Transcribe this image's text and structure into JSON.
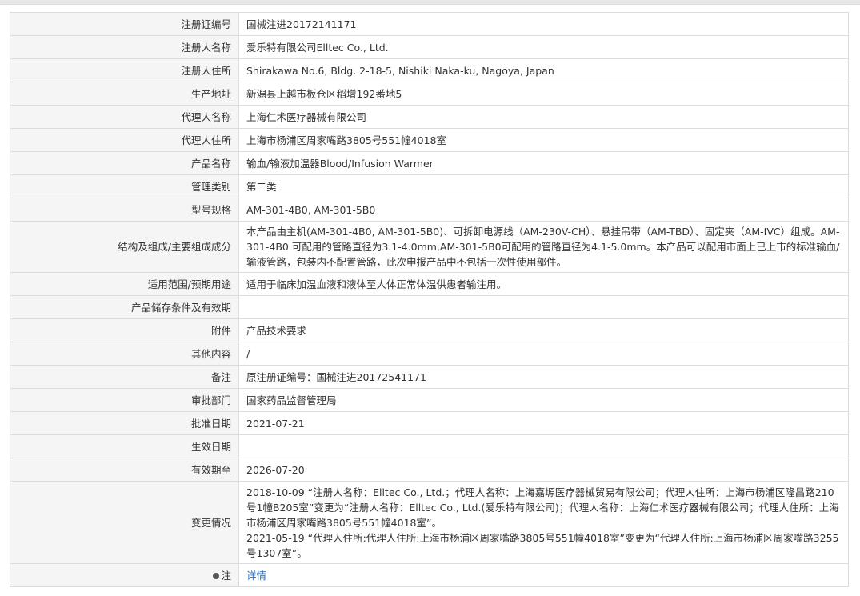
{
  "rows": [
    {
      "label": "注册证编号",
      "value": "国械注进20172141171"
    },
    {
      "label": "注册人名称",
      "value": "爱乐特有限公司Elltec Co., Ltd."
    },
    {
      "label": "注册人住所",
      "value": "Shirakawa No.6, Bldg. 2-18-5, Nishiki Naka-ku, Nagoya, Japan"
    },
    {
      "label": "生产地址",
      "value": "新潟县上越市板仓区稻增192番地5"
    },
    {
      "label": "代理人名称",
      "value": "上海仁术医疗器械有限公司"
    },
    {
      "label": "代理人住所",
      "value": "上海市杨浦区周家嘴路3805号551幢4018室"
    },
    {
      "label": "产品名称",
      "value": "输血/输液加温器Blood/Infusion Warmer"
    },
    {
      "label": "管理类别",
      "value": "第二类"
    },
    {
      "label": "型号规格",
      "value": "AM-301-4B0, AM-301-5B0"
    },
    {
      "label": "结构及组成/主要组成成分",
      "value": "本产品由主机(AM-301-4B0, AM-301-5B0)、可拆卸电源线（AM-230V-CH）、悬挂吊带（AM-TBD）、固定夹（AM-IVC）组成。AM-301-4B0 可配用的管路直径为3.1-4.0mm,AM-301-5B0可配用的管路直径为4.1-5.0mm。本产品可以配用市面上已上市的标准输血/输液管路，包装内不配置管路，此次申报产品中不包括一次性使用部件。"
    },
    {
      "label": "适用范围/预期用途",
      "value": "适用于临床加温血液和液体至人体正常体温供患者输注用。"
    },
    {
      "label": "产品储存条件及有效期",
      "value": ""
    },
    {
      "label": "附件",
      "value": "产品技术要求"
    },
    {
      "label": "其他内容",
      "value": "/"
    },
    {
      "label": "备注",
      "value": "原注册证编号：国械注进20172541171"
    },
    {
      "label": "审批部门",
      "value": "国家药品监督管理局"
    },
    {
      "label": "批准日期",
      "value": "2021-07-21"
    },
    {
      "label": "生效日期",
      "value": ""
    },
    {
      "label": "有效期至",
      "value": "2026-07-20"
    }
  ],
  "changes": {
    "label": "变更情况",
    "entry1": "2018-10-09 “注册人名称：Elltec Co., Ltd.；代理人名称：上海嘉塬医疗器械贸易有限公司；代理人住所：上海市杨浦区隆昌路210号1幢B205室”变更为“注册人名称：Elltec Co., Ltd.(爱乐特有限公司)；代理人名称：上海仁术医疗器械有限公司；代理人住所：上海市杨浦区周家嘴路3805号551幢4018室”。",
    "entry2": "2021-05-19 “代理人住所:代理人住所:上海市杨浦区周家嘴路3805号551幢4018室”变更为“代理人住所:上海市杨浦区周家嘴路3255号1307室”。"
  },
  "note": {
    "label": "注",
    "link_text": "详情",
    "icon": "pin-icon"
  }
}
